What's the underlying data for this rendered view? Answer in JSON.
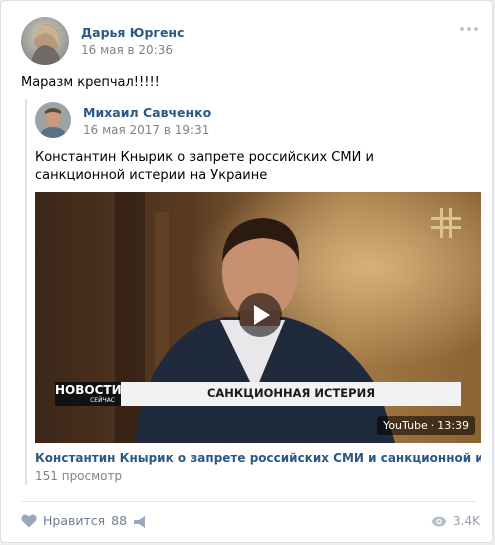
{
  "post": {
    "author": "Дарья Юргенс",
    "date": "16 мая в 20:36",
    "text": "Маразм крепчал!!!!!"
  },
  "repost": {
    "author": "Михаил Савченко",
    "date": "16 мая 2017 в 19:31",
    "text": "Константин Кнырик о запрете российских СМИ и санкционной истерии на Украине"
  },
  "video": {
    "news_logo": "НОВОСТИ",
    "news_logo_sub": "СЕЙЧАС",
    "caption": "САНКЦИОННАЯ ИСТЕРИЯ",
    "source": "YouTube",
    "duration": "13:39",
    "title": "Константин Кнырик о запрете российских СМИ и санкционной истерии на Украине",
    "views": "151 просмотр"
  },
  "footer": {
    "like_label": "Нравится",
    "like_count": "88",
    "views": "3.4K"
  },
  "colors": {
    "link": "#2a5885",
    "muted": "#828282",
    "action": "#6b7e92"
  },
  "icons": [
    "more-icon",
    "heart-icon",
    "share-icon",
    "eye-icon",
    "play-icon",
    "channel-logo-icon"
  ]
}
